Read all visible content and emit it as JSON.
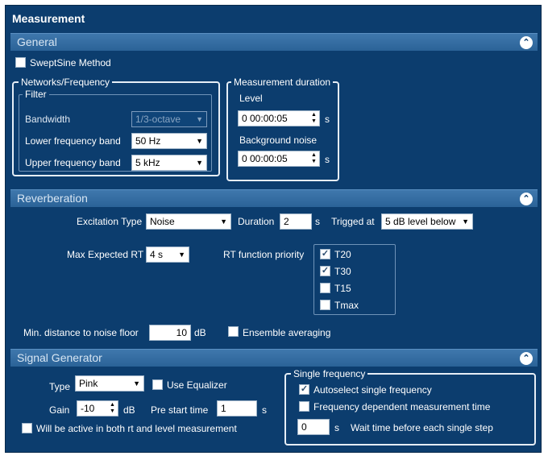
{
  "title": "Measurement",
  "colors": {
    "panel": "#0c3d6e",
    "header": "#2b6397",
    "header_text": "#d8e6f3"
  },
  "general": {
    "header": "General",
    "sweptsine": {
      "label": "SweptSine Method",
      "checked": false
    },
    "networks": {
      "legend": "Networks/Frequency",
      "filter_legend": "Filter",
      "bandwidth_label": "Bandwidth",
      "bandwidth_value": "1/3-octave",
      "lower_label": "Lower frequency band",
      "lower_value": "50 Hz",
      "upper_label": "Upper frequency band",
      "upper_value": "5 kHz"
    },
    "duration": {
      "legend": "Measurement duration",
      "level_label": "Level",
      "level_value": "0 00:00:05",
      "level_unit": "s",
      "bg_label": "Background noise",
      "bg_value": "0 00:00:05",
      "bg_unit": "s"
    }
  },
  "reverberation": {
    "header": "Reverberation",
    "excitation_label": "Excitation Type",
    "excitation_value": "Noise",
    "duration_label": "Duration",
    "duration_value": "2",
    "duration_unit": "s",
    "trigged_label": "Trigged at",
    "trigged_value": "5 dB level below",
    "max_rt_label": "Max Expected RT",
    "max_rt_value": "4 s",
    "rt_priority_label": "RT function priority",
    "rt_items": [
      {
        "label": "T20",
        "checked": true
      },
      {
        "label": "T30",
        "checked": true
      },
      {
        "label": "T15",
        "checked": false
      },
      {
        "label": "Tmax",
        "checked": false
      }
    ],
    "min_distance_label": "Min. distance to noise floor",
    "min_distance_value": "10",
    "min_distance_unit": "dB",
    "ensemble_label": "Ensemble averaging",
    "ensemble_checked": false
  },
  "signal_generator": {
    "header": "Signal Generator",
    "type_label": "Type",
    "type_value": "Pink",
    "use_eq_label": "Use Equalizer",
    "gain_label": "Gain",
    "gain_value": "-10",
    "gain_unit": "dB",
    "pre_start_label": "Pre start time",
    "pre_start_value": "1",
    "pre_start_unit": "s",
    "active_both_label": "Will be active in both rt and level measurement",
    "single_freq": {
      "legend": "Single frequency",
      "autoselect_label": "Autoselect single frequency",
      "autoselect_checked": true,
      "freq_dep_label": "Frequency dependent measurement time",
      "freq_dep_checked": false,
      "wait_value": "0",
      "wait_unit": "s",
      "wait_label": "Wait time before each single step"
    }
  }
}
